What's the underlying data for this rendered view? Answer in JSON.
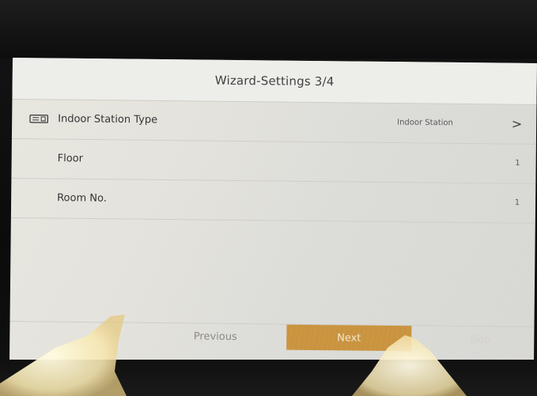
{
  "window": {
    "title": "Wizard-Settings 3/4"
  },
  "rows": [
    {
      "icon": "indoor-station-icon",
      "label": "Indoor Station Type",
      "value": "Indoor Station",
      "chevron": ">"
    },
    {
      "label": "Floor",
      "value": "1"
    },
    {
      "label": "Room No.",
      "value": "1"
    }
  ],
  "footer": {
    "previous_label": "Previous",
    "next_label": "Next",
    "skip_label": "Skip"
  },
  "colors": {
    "accent": "#c9913a",
    "screen_bg": "#e6e4de",
    "bezel": "#0d0d0d"
  }
}
